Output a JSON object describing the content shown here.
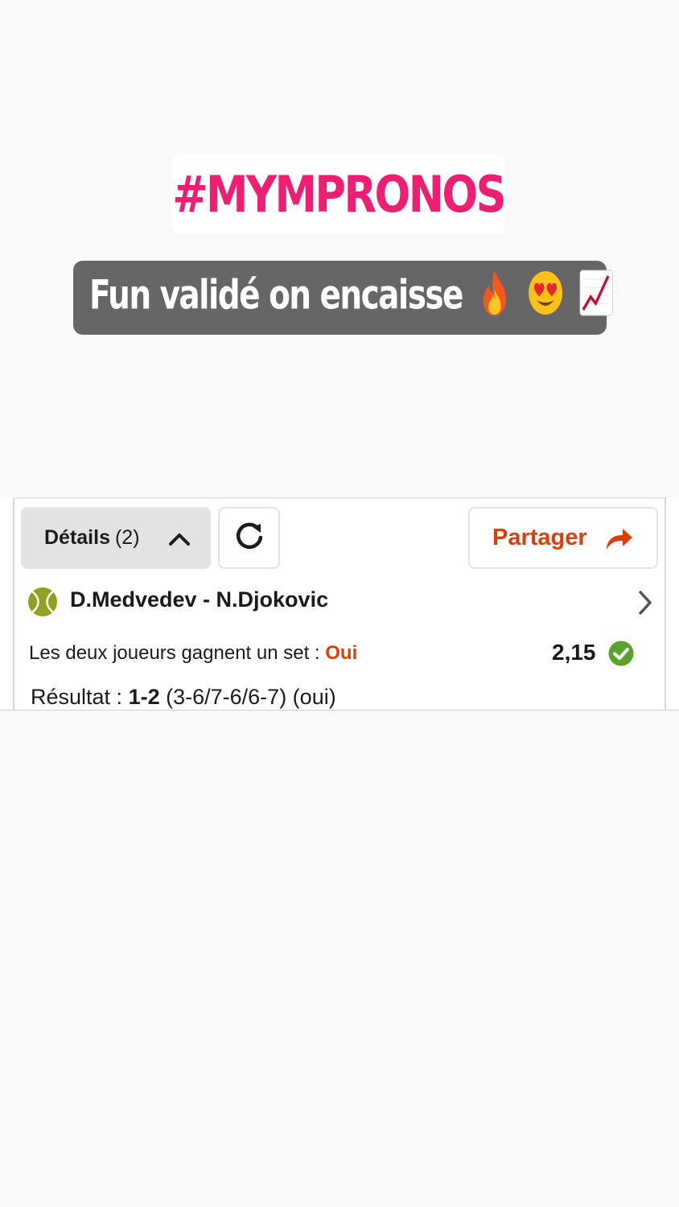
{
  "story": {
    "hashtag": "#MYMPRONOS",
    "caption": "Fun validé on encaisse",
    "caption_emojis": [
      "fire-emoji",
      "heart-eyes-emoji",
      "chart-increasing-emoji"
    ],
    "colors": {
      "hashtag": "#ee1e72",
      "caption_bg": "#666666"
    }
  },
  "toolbar": {
    "details_label": "Détails",
    "details_count": "(2)",
    "share_label": "Partager",
    "icons": [
      "chevron-up-icon",
      "refresh-icon",
      "share-arrow-icon"
    ]
  },
  "match": {
    "sport_icon": "tennis-ball-icon",
    "name": "D.Medvedev - N.Djokovic",
    "bet_label": "Les deux joueurs gagnent un set :",
    "bet_value": "Oui",
    "odds": "2,15",
    "status_icon": "check-circle-icon",
    "result_label": "Résultat :",
    "result_score": "1-2",
    "result_detail": "(3-6/7-6/6-7) (oui)"
  },
  "colors": {
    "accent": "#d9400a",
    "success": "#5aa22a",
    "tennis_ball": "#8fa11f"
  }
}
